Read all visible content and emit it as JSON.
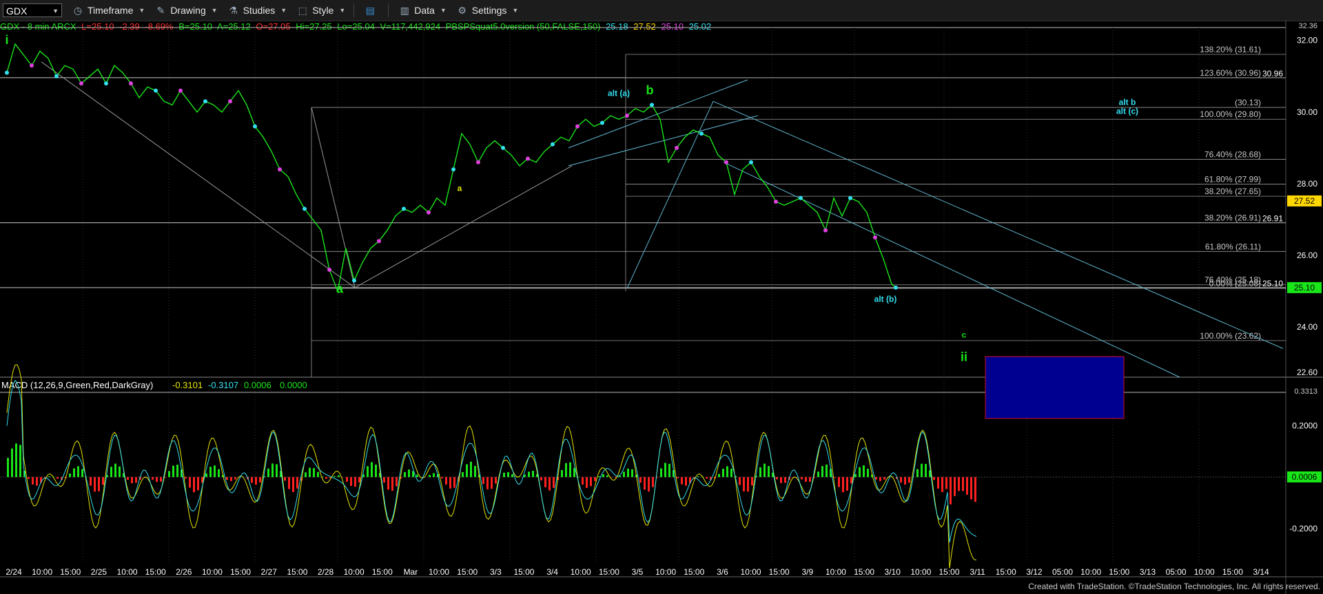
{
  "toolbar": {
    "symbol": "GDX",
    "items": [
      {
        "label": "Timeframe",
        "icon": "clock-icon"
      },
      {
        "label": "Drawing",
        "icon": "pencil-icon"
      },
      {
        "label": "Studies",
        "icon": "flask-icon"
      },
      {
        "label": "Style",
        "icon": "style-icon"
      },
      {
        "label": "Data",
        "icon": "bar-chart-icon"
      },
      {
        "label": "Settings",
        "icon": "gear-icon"
      }
    ]
  },
  "header": {
    "symbol_line": "GDX - 8 min  ARCX",
    "last": "L=25.10",
    "change": "-2.39",
    "change_pct": "-8.69%",
    "bid": "B=25.10",
    "ask": "A=25.12",
    "open": "O=27.05",
    "hi": "Hi=27.25",
    "lo": "Lo=25.04",
    "volume": "V=117,442,924",
    "study": "PBSPSquat5.0version (50,FALSE,150)",
    "study_values": [
      "25.18",
      "27.52",
      "25.10",
      "25.02"
    ]
  },
  "macd_header": {
    "label": "MACD (12,26,9,Green,Red,DarkGray)",
    "values": [
      "-0.3101",
      "-0.3107",
      "0.0006",
      "0.0000"
    ]
  },
  "colors": {
    "green": "#19e619",
    "red": "#ff2020",
    "cyan": "#33e0f0",
    "magenta": "#e040e0",
    "gold": "#ffd700",
    "yellow": "#e6e600",
    "blue_box": "#000090"
  },
  "chart_data": {
    "type": "line",
    "price_axis": {
      "ticks": [
        "32.00",
        "30.00",
        "28.00",
        "26.00",
        "24.00"
      ],
      "top_label": "32.36",
      "bottom_label": "22.60",
      "ylim": [
        22.6,
        32.36
      ]
    },
    "x_ticks": [
      "2/24",
      "10:00",
      "15:00",
      "2/25",
      "10:00",
      "15:00",
      "2/26",
      "10:00",
      "15:00",
      "2/27",
      "15:00",
      "2/28",
      "10:00",
      "15:00",
      "Mar",
      "10:00",
      "15:00",
      "3/3",
      "15:00",
      "3/4",
      "10:00",
      "15:00",
      "3/5",
      "10:00",
      "15:00",
      "3/6",
      "10:00",
      "15:00",
      "3/9",
      "10:00",
      "15:00",
      "3/10",
      "10:00",
      "15:00",
      "3/11",
      "15:00",
      "3/12",
      "05:00",
      "10:00",
      "15:00",
      "3/13",
      "05:00",
      "10:00",
      "15:00",
      "3/14"
    ],
    "price_badges": [
      {
        "value": "27.52",
        "color": "gold"
      },
      {
        "value": "25.10",
        "color": "green"
      }
    ],
    "horizontal_levels": [
      {
        "label": "30.96",
        "value": 30.96
      },
      {
        "label": "26.91",
        "value": 26.91
      },
      {
        "label": "25.10",
        "value": 25.1
      }
    ],
    "fib_right": [
      {
        "text": "138.20% (31.61)",
        "value": 31.61
      },
      {
        "text": "123.60% (30.96)",
        "value": 30.96
      },
      {
        "text": "(30.13)",
        "value": 30.13
      },
      {
        "text": "100.00% (29.80)",
        "value": 29.8
      },
      {
        "text": "76.40% (28.68)",
        "value": 28.68
      },
      {
        "text": "61.80% (27.99)",
        "value": 27.99
      },
      {
        "text": "38.20% (27.65)",
        "value": 27.65
      },
      {
        "text": "38.20% (26.91)",
        "value": 26.91
      },
      {
        "text": "61.80% (26.11)",
        "value": 26.11
      },
      {
        "text": "76.40% (25.18)",
        "value": 25.18
      },
      {
        "text": "0.00% (25.08)",
        "value": 25.08
      },
      {
        "text": "100.00% (23.62)",
        "value": 23.62
      }
    ],
    "wave_labels": [
      {
        "text": "i",
        "color": "green",
        "x": 0,
        "y": 31.9
      },
      {
        "text": "a",
        "color": "green",
        "x": 161,
        "y": 24.95
      },
      {
        "text": "a",
        "color": "yellow",
        "x": 219,
        "y": 27.8
      },
      {
        "text": "alt (a)",
        "color": "cyan",
        "x": 296,
        "y": 30.45
      },
      {
        "text": "b",
        "color": "green",
        "x": 311,
        "y": 30.5
      },
      {
        "text": "alt (b)",
        "color": "cyan",
        "x": 425,
        "y": 24.7
      },
      {
        "text": "c",
        "color": "green",
        "x": 463,
        "y": 23.7
      },
      {
        "text": "ii",
        "color": "green",
        "x": 463,
        "y": 23.05
      },
      {
        "text": "alt b",
        "color": "cyan",
        "x": 542,
        "y": 30.2
      },
      {
        "text": "alt (c)",
        "color": "cyan",
        "x": 542,
        "y": 29.95
      }
    ],
    "price_series": [
      [
        0,
        31.1
      ],
      [
        4,
        31.9
      ],
      [
        8,
        31.6
      ],
      [
        12,
        31.3
      ],
      [
        16,
        31.7
      ],
      [
        20,
        31.5
      ],
      [
        24,
        31.0
      ],
      [
        28,
        31.3
      ],
      [
        32,
        31.2
      ],
      [
        36,
        30.8
      ],
      [
        40,
        31.0
      ],
      [
        44,
        31.2
      ],
      [
        48,
        30.8
      ],
      [
        52,
        31.3
      ],
      [
        56,
        31.1
      ],
      [
        60,
        30.8
      ],
      [
        64,
        30.4
      ],
      [
        68,
        30.7
      ],
      [
        72,
        30.6
      ],
      [
        76,
        30.3
      ],
      [
        80,
        30.2
      ],
      [
        84,
        30.6
      ],
      [
        88,
        30.3
      ],
      [
        92,
        30.0
      ],
      [
        96,
        30.3
      ],
      [
        100,
        30.2
      ],
      [
        104,
        30.0
      ],
      [
        108,
        30.3
      ],
      [
        112,
        30.6
      ],
      [
        116,
        30.2
      ],
      [
        120,
        29.6
      ],
      [
        124,
        29.3
      ],
      [
        128,
        28.9
      ],
      [
        132,
        28.4
      ],
      [
        136,
        28.2
      ],
      [
        140,
        27.7
      ],
      [
        144,
        27.3
      ],
      [
        148,
        27.0
      ],
      [
        152,
        26.7
      ],
      [
        156,
        25.6
      ],
      [
        160,
        25.0
      ],
      [
        164,
        26.2
      ],
      [
        168,
        25.3
      ],
      [
        172,
        25.8
      ],
      [
        176,
        26.2
      ],
      [
        180,
        26.4
      ],
      [
        184,
        26.7
      ],
      [
        188,
        27.1
      ],
      [
        192,
        27.3
      ],
      [
        196,
        27.2
      ],
      [
        200,
        27.4
      ],
      [
        204,
        27.2
      ],
      [
        208,
        27.6
      ],
      [
        212,
        27.4
      ],
      [
        216,
        28.4
      ],
      [
        220,
        29.4
      ],
      [
        224,
        29.1
      ],
      [
        228,
        28.6
      ],
      [
        232,
        29.0
      ],
      [
        236,
        29.2
      ],
      [
        240,
        29.0
      ],
      [
        244,
        28.8
      ],
      [
        248,
        28.5
      ],
      [
        252,
        28.7
      ],
      [
        256,
        28.6
      ],
      [
        260,
        28.9
      ],
      [
        264,
        29.1
      ],
      [
        268,
        29.3
      ],
      [
        272,
        29.2
      ],
      [
        276,
        29.6
      ],
      [
        280,
        29.8
      ],
      [
        284,
        29.6
      ],
      [
        288,
        29.7
      ],
      [
        292,
        29.9
      ],
      [
        296,
        29.8
      ],
      [
        300,
        29.9
      ],
      [
        304,
        30.1
      ],
      [
        308,
        30.0
      ],
      [
        312,
        30.2
      ],
      [
        316,
        29.8
      ],
      [
        320,
        28.6
      ],
      [
        324,
        29.0
      ],
      [
        328,
        29.3
      ],
      [
        332,
        29.5
      ],
      [
        336,
        29.4
      ],
      [
        340,
        29.3
      ],
      [
        344,
        28.8
      ],
      [
        348,
        28.6
      ],
      [
        352,
        27.7
      ],
      [
        356,
        28.4
      ],
      [
        360,
        28.6
      ],
      [
        364,
        28.2
      ],
      [
        368,
        27.9
      ],
      [
        372,
        27.5
      ],
      [
        376,
        27.4
      ],
      [
        380,
        27.5
      ],
      [
        384,
        27.6
      ],
      [
        388,
        27.4
      ],
      [
        392,
        27.2
      ],
      [
        396,
        26.7
      ],
      [
        400,
        27.6
      ],
      [
        404,
        27.1
      ],
      [
        408,
        27.6
      ],
      [
        412,
        27.5
      ],
      [
        416,
        27.2
      ],
      [
        420,
        26.5
      ],
      [
        424,
        25.9
      ],
      [
        428,
        25.2
      ],
      [
        430,
        25.1
      ]
    ],
    "macd": {
      "axis_ticks": [
        "0.2000",
        "-0.2000"
      ],
      "top_label": "0.3313",
      "badge": "0.0006",
      "ylim": [
        -0.34,
        0.33
      ]
    }
  },
  "footer": "Created with TradeStation. ©TradeStation Technologies, Inc. All rights reserved."
}
